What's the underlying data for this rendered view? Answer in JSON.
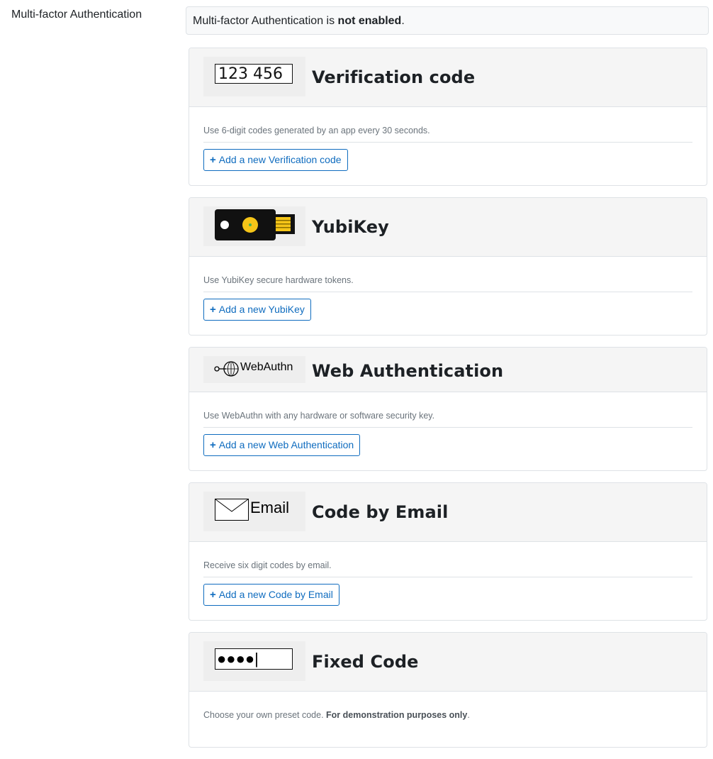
{
  "section_label": "Multi-factor Authentication",
  "status": {
    "prefix": "Multi-factor Authentication is ",
    "state": "not enabled",
    "suffix": "."
  },
  "factors": [
    {
      "title": "Verification code",
      "logo_text": "123 456",
      "description": "Use 6-digit codes generated by an app every 30 seconds.",
      "button_label": "Add a new Verification code"
    },
    {
      "title": "YubiKey",
      "description": "Use YubiKey secure hardware tokens.",
      "button_label": "Add a new YubiKey"
    },
    {
      "title": "Web Authentication",
      "logo_text": "WebAuthn",
      "description": "Use WebAuthn with any hardware or software security key.",
      "button_label": "Add a new Web Authentication"
    },
    {
      "title": "Code by Email",
      "logo_text": "Email",
      "description": "Receive six digit codes by email.",
      "button_label": "Add a new Code by Email"
    },
    {
      "title": "Fixed Code",
      "logo_text": "●●●●|",
      "description": "Choose your own preset code. ",
      "description_bold": "For demonstration purposes only",
      "description_suffix": "."
    }
  ],
  "icons": {
    "plus": "+"
  },
  "colors": {
    "link": "#0f6cbf",
    "yubikey_gold": "#f5c518",
    "yubikey_body": "#111111"
  }
}
